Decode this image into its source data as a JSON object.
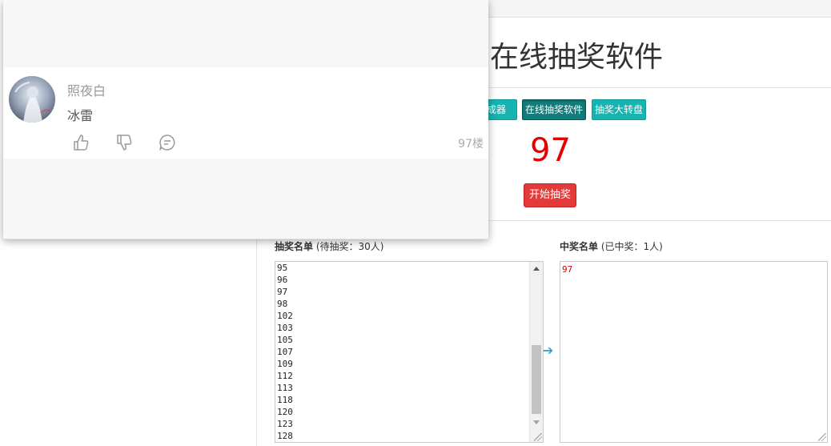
{
  "page": {
    "title": "在线抽奖软件",
    "tabs": [
      "生成器",
      "在线抽奖软件",
      "抽奖大转盘"
    ],
    "active_tab": "在线抽奖软件",
    "result_number": "97",
    "start_button": "开始抽奖"
  },
  "pending": {
    "label": "抽奖名单",
    "count": "(待抽奖：30人)",
    "items": [
      "95",
      "96",
      "97",
      "98",
      "102",
      "103",
      "105",
      "107",
      "109",
      "112",
      "113",
      "118",
      "120",
      "123",
      "128"
    ]
  },
  "winners": {
    "label": "中奖名单",
    "count": "(已中奖：1人)",
    "items": [
      "97"
    ]
  },
  "comment": {
    "username": "照夜白",
    "text": "冰雷",
    "floor": "97楼"
  },
  "colors": {
    "accent": "#17b3b0",
    "active_tab": "#127c7a",
    "result_red": "#e40000",
    "start_red": "#e33a3a"
  },
  "icons": [
    "like-icon",
    "dislike-icon",
    "reply-icon",
    "transfer-arrow-icon",
    "avatar"
  ]
}
